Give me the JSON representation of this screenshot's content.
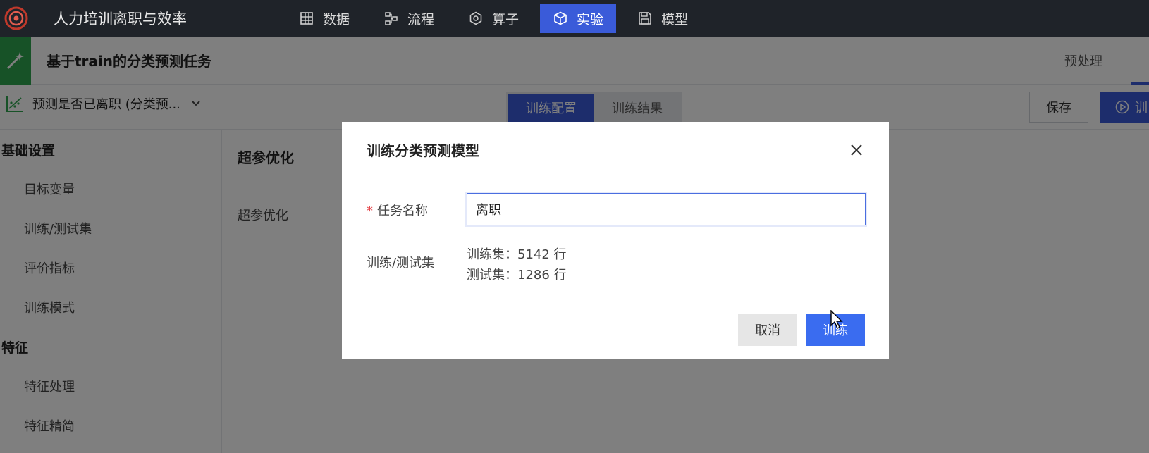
{
  "app": {
    "title": "人力培训离职与效率"
  },
  "nav": {
    "items": [
      {
        "label": "数据",
        "icon": "grid-icon",
        "active": false
      },
      {
        "label": "流程",
        "icon": "flow-icon",
        "active": false
      },
      {
        "label": "算子",
        "icon": "hexagon-icon",
        "active": false
      },
      {
        "label": "实验",
        "icon": "cube-icon",
        "active": true
      },
      {
        "label": "模型",
        "icon": "save-icon",
        "active": false
      }
    ]
  },
  "task": {
    "title": "基于train的分类预测任务",
    "tabs": [
      "预处理"
    ]
  },
  "toolbar": {
    "model_label": "预测是否已离职 (分类预...",
    "segments": [
      "训练配置",
      "训练结果"
    ],
    "save_label": "保存",
    "run_label": "训"
  },
  "sidebar": {
    "groups": [
      {
        "title": "基础设置",
        "items": [
          "目标变量",
          "训练/测试集",
          "评价指标",
          "训练模式"
        ]
      },
      {
        "title": "特征",
        "items": [
          "特征处理",
          "特征精简"
        ]
      }
    ]
  },
  "main": {
    "section_title": "超参优化",
    "field_label": "超参优化"
  },
  "modal": {
    "title": "训练分类预测模型",
    "required_mark": "*",
    "name_label": "任务名称",
    "name_value": "离职",
    "set_label": "训练/测试集",
    "train_set": "训练集：5142 行",
    "test_set": "测试集：1286 行",
    "cancel_label": "取消",
    "train_label": "训练"
  },
  "colors": {
    "accent": "#3a5bd9",
    "topbar": "#1f2329",
    "task_icon_bg": "#2ea44f"
  }
}
